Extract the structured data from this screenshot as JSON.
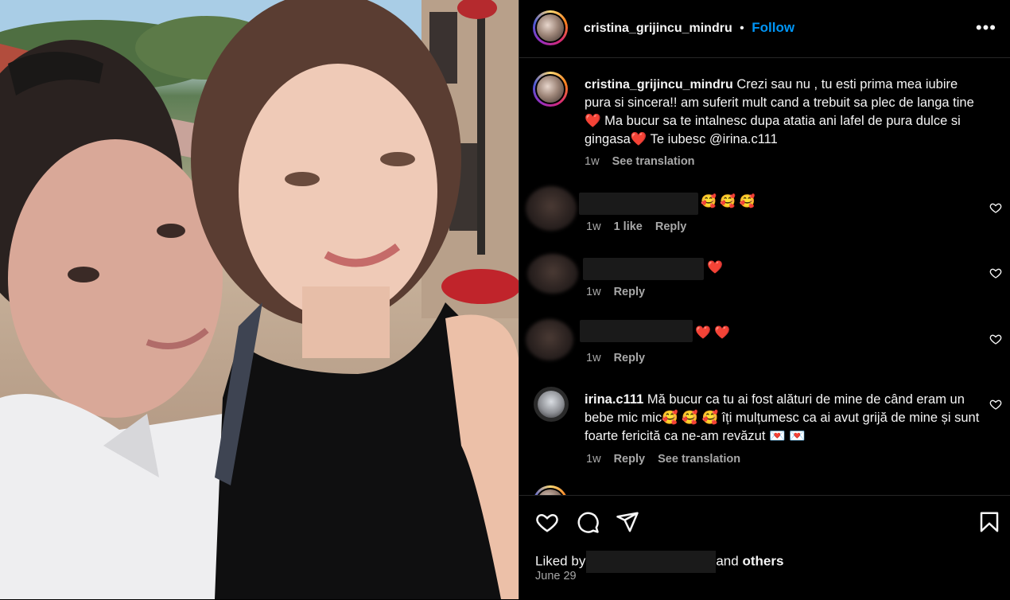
{
  "post": {
    "author": "cristina_grijincu_mindru",
    "separator": "•",
    "follow_label": "Follow",
    "more_label": "•••"
  },
  "caption": {
    "username": "cristina_grijincu_mindru",
    "text_part1": "Crezi sau nu , tu esti prima mea iubire pura si sincera!! am suferit mult cand a trebuit sa plec de langa tine",
    "text_part2": " Ma bucur sa te intalnesc dupa atatia ani lafel de pura dulce si gingasa",
    "text_part3": " Te iubesc @irina.c111",
    "heart": "❤️",
    "time": "1w",
    "see_translation": "See translation"
  },
  "comments": [
    {
      "emojis": "🥰 🥰 🥰",
      "time": "1w",
      "likes": "1 like",
      "reply": "Reply"
    },
    {
      "emojis": "❤️",
      "time": "1w",
      "reply": "Reply"
    },
    {
      "emojis": "❤️ ❤️",
      "time": "1w",
      "reply": "Reply"
    },
    {
      "username": "irina.c111",
      "text": "Mă bucur ca tu ai fost alături de mine de când eram un bebe mic mic🥰 🥰 🥰 îți mulțumesc ca ai avut grijă de mine și sunt foarte fericită ca ne-am revăzut 💌 💌",
      "time": "1w",
      "reply": "Reply",
      "see_translation": "See translation"
    }
  ],
  "footer": {
    "liked_prefix": "Liked by",
    "liked_suffix": "and",
    "others": "others",
    "date": "June 29"
  },
  "colors": {
    "accent": "#0095f6",
    "text": "#f5f5f5",
    "muted": "#a8a8a8",
    "background": "#000000"
  },
  "icons": [
    "heart-icon",
    "comment-icon",
    "share-icon",
    "bookmark-icon",
    "more-icon"
  ]
}
